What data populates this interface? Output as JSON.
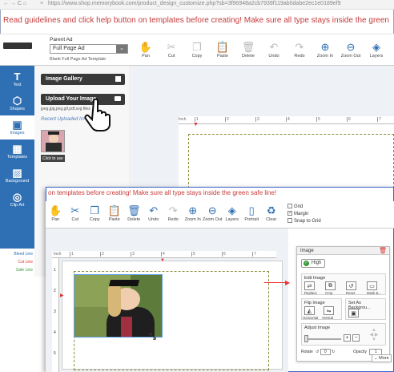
{
  "browser": {
    "nav_icons": "← → C ⌂",
    "url": "https://www.shop.memorybook.com/product_design_customize.php?sb=3f96948a2cb7939f119ab0dabe2ec1e0189ef9",
    "url_prefix": "≡"
  },
  "banner": {
    "text": "Read guidelines and click help button on templates before creating! Make sure all type stays inside the green"
  },
  "header": {
    "template_label": "Parent Ad",
    "template_select": "Full Page Ad",
    "template_sub": "Blank Full Page Ad Template"
  },
  "toolbar": [
    {
      "label": "Pan",
      "icon": "✋",
      "enabled": true
    },
    {
      "label": "Cut",
      "icon": "✂",
      "enabled": false
    },
    {
      "label": "Copy",
      "icon": "❐",
      "enabled": false
    },
    {
      "label": "Paste",
      "icon": "📋",
      "enabled": false
    },
    {
      "label": "Delete",
      "icon": "🗑",
      "enabled": false
    },
    {
      "label": "Undo",
      "icon": "↶",
      "enabled": false
    },
    {
      "label": "Redo",
      "icon": "↷",
      "enabled": false
    },
    {
      "label": "Zoom In",
      "icon": "⊕",
      "enabled": true
    },
    {
      "label": "Zoom Out",
      "icon": "⊖",
      "enabled": true
    },
    {
      "label": "Layers",
      "icon": "◈",
      "enabled": true
    }
  ],
  "sidebar": [
    {
      "label": "Text",
      "icon": "T",
      "active": false
    },
    {
      "label": "Shapes",
      "icon": "⬡",
      "active": false
    },
    {
      "label": "Images",
      "icon": "▣",
      "active": true
    },
    {
      "label": "Templates",
      "icon": "▦",
      "active": false
    },
    {
      "label": "Background",
      "icon": "▨",
      "active": false
    },
    {
      "label": "Clip Art",
      "icon": "◎",
      "active": false
    }
  ],
  "legend": [
    {
      "label": "Bleed Line",
      "color": "#2f6fb3"
    },
    {
      "label": "Cut Line",
      "color": "#d33"
    },
    {
      "label": "Safe Line",
      "color": "#3a9a3a"
    }
  ],
  "images_panel": {
    "gallery_btn": "Image Gallery",
    "upload_btn": "Upload Your Image",
    "formats": "jpeg,jpg,png,gif,pdf,svg files",
    "recent": "Recent Uploaded Im",
    "tooltip": "Click to use"
  },
  "ruler": {
    "label": "Inch",
    "ticks": [
      "1",
      "2",
      "3",
      "4",
      "5",
      "6",
      "7"
    ]
  },
  "fg": {
    "banner": "on templates before creating! Make sure all type stays inside the green safe line!",
    "toolbar": [
      {
        "label": "Pan",
        "icon": "✋",
        "enabled": true
      },
      {
        "label": "Cut",
        "icon": "✂",
        "enabled": true
      },
      {
        "label": "Copy",
        "icon": "❐",
        "enabled": true
      },
      {
        "label": "Paste",
        "icon": "📋",
        "enabled": false
      },
      {
        "label": "Delete",
        "icon": "🗑",
        "enabled": true
      },
      {
        "label": "Undo",
        "icon": "↶",
        "enabled": true
      },
      {
        "label": "Redo",
        "icon": "↷",
        "enabled": false
      },
      {
        "label": "Zoom In",
        "icon": "⊕",
        "enabled": true
      },
      {
        "label": "Zoom Out",
        "icon": "⊖",
        "enabled": true
      },
      {
        "label": "Layers",
        "icon": "◈",
        "enabled": true
      },
      {
        "label": "Portrait",
        "icon": "▯",
        "enabled": true
      },
      {
        "label": "Clear",
        "icon": "♻",
        "enabled": true
      }
    ],
    "options": [
      {
        "label": "Grid",
        "checked": false
      },
      {
        "label": "Margin",
        "checked": true
      },
      {
        "label": "Snap to Grid",
        "checked": false
      }
    ],
    "ruler_ticks": [
      "1",
      "2",
      "3",
      "4",
      "5",
      "6",
      "7"
    ],
    "ruler_left": [
      "1",
      "2",
      "3",
      "4",
      "5"
    ]
  },
  "props": {
    "title": "Image",
    "quality": "High",
    "edit_title": "Edit Image",
    "edit_items": [
      "Replace",
      "Crop",
      "Reset",
      "Mask &..."
    ],
    "flip_title": "Flip Image",
    "flip_items": [
      "Horizontal",
      "Vertical"
    ],
    "bg_title": "Set As Backgrou...",
    "adjust_title": "Adjust Image",
    "rotate_label": "Rotate",
    "rotate_value": "0",
    "opacity_label": "Opacity",
    "opacity_value": "1",
    "more": "More"
  },
  "colors": {
    "accent": "#2f6fb3",
    "danger": "#d33",
    "safe": "#3a9a3a",
    "banner": "#c73a3a"
  }
}
